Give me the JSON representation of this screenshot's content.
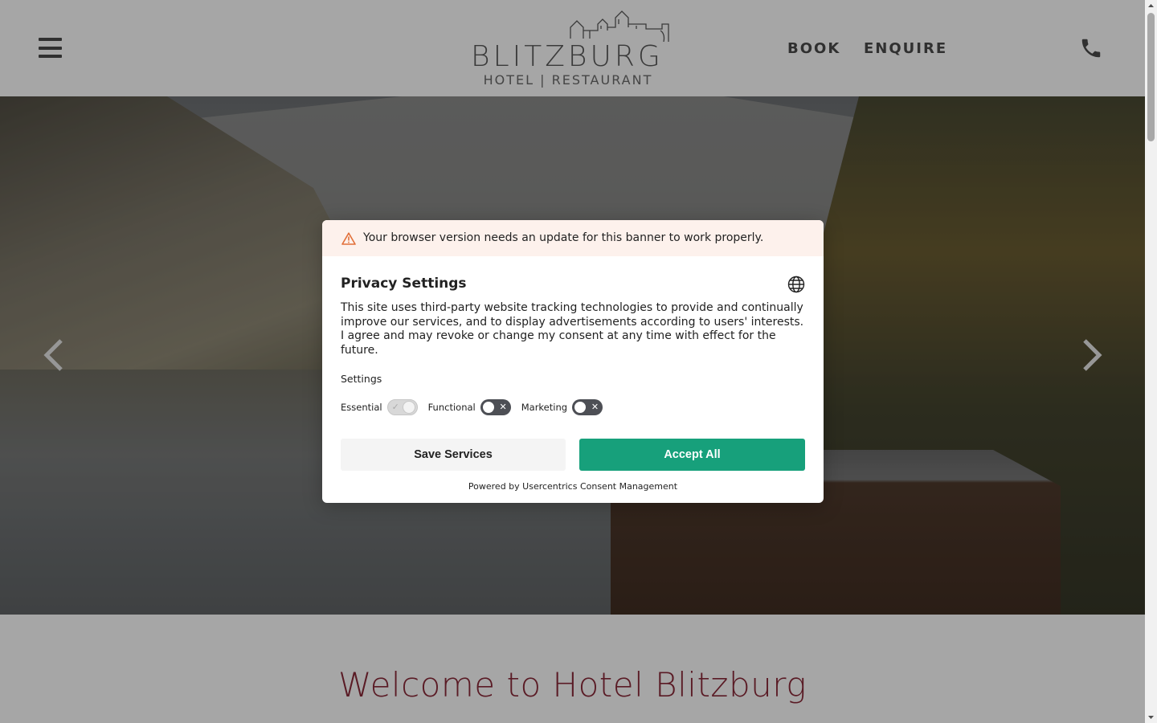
{
  "header": {
    "logo_name": "BLITZBURG",
    "logo_sub": "HOTEL | RESTAURANT",
    "nav": {
      "book": "BOOK",
      "enquire": "ENQUIRE"
    },
    "icons": {
      "menu": "hamburger-menu-icon",
      "phone": "phone-icon"
    }
  },
  "hero": {
    "icons": {
      "prev": "chevron-left-icon",
      "next": "chevron-right-icon"
    }
  },
  "main": {
    "welcome_title": "Welcome to Hotel Blitzburg"
  },
  "consent": {
    "warning": "Your browser version needs an update for this banner to work properly.",
    "title": "Privacy Settings",
    "description": "This site uses third-party website tracking technologies to provide and continually improve our services, and to display advertisements according to users' interests. I agree and may revoke or change my consent at any time with effect for the future.",
    "settings_label": "Settings",
    "toggles": [
      {
        "label": "Essential",
        "state": "on"
      },
      {
        "label": "Functional",
        "state": "off"
      },
      {
        "label": "Marketing",
        "state": "off"
      }
    ],
    "save_label": "Save Services",
    "accept_label": "Accept All",
    "powered_by": "Powered by Usercentrics Consent Management",
    "colors": {
      "accept": "#17a07b",
      "warning_bg": "#fdf1ec",
      "warning_icon": "#e2703a"
    }
  }
}
